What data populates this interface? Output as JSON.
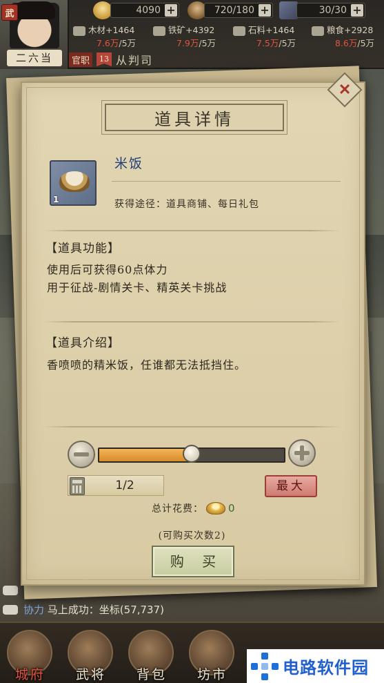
{
  "hud": {
    "avatar_badge": "武",
    "player_name": "二六当",
    "resources": [
      {
        "name": "silver",
        "value": "4090"
      },
      {
        "name": "stamina",
        "value": "720/180"
      },
      {
        "name": "army",
        "value": "30/30"
      }
    ],
    "production": [
      {
        "name": "木材+1464",
        "stock": "7.6万",
        "cap": "/5万"
      },
      {
        "name": "铁矿+4392",
        "stock": "7.9万",
        "cap": "/5万"
      },
      {
        "name": "石料+1464",
        "stock": "7.5万",
        "cap": "/5万"
      },
      {
        "name": "粮食+2928",
        "stock": "8.6万",
        "cap": "/5万"
      }
    ],
    "rank_tag": "官职",
    "rank_level": "13",
    "rank_name": "从判司",
    "plus_icon": "plus-icon"
  },
  "dialog": {
    "title": "道具详情",
    "close_icon": "close-icon",
    "item": {
      "name": "米饭",
      "count": "1",
      "source": "获得途径：道具商铺、每日礼包",
      "icon": "rice-bowl-icon"
    },
    "function_title": "【道具功能】",
    "function_lines": [
      "使用后可获得60点体力",
      "用于征战-剧情关卡、精英关卡挑战"
    ],
    "intro_title": "【道具介绍】",
    "intro_text": "香喷喷的精米饭，任谁都无法抵挡住。",
    "quantity": {
      "value": "1/2",
      "slider_fraction": 0.5,
      "max_label": "最大"
    },
    "cost_label": "总计花费：",
    "cost_value": "0",
    "buy_remaining": "(可购买次数2)",
    "buy_label": "购 买"
  },
  "chat": {
    "tag": "协力",
    "message": "马上成功：坐标(57,737)"
  },
  "nav": [
    {
      "label": "城府",
      "active": true
    },
    {
      "label": "武将",
      "active": false
    },
    {
      "label": "背包",
      "active": false
    },
    {
      "label": "坊市",
      "active": false
    }
  ],
  "watermark": "电路软件园",
  "colors": {
    "paper": "#e2d6b3",
    "accent_orange": "#e6a040",
    "item_name_blue": "#233e7a",
    "max_button_red": "#cd7b72",
    "buy_button_green": "#c8cda0"
  }
}
